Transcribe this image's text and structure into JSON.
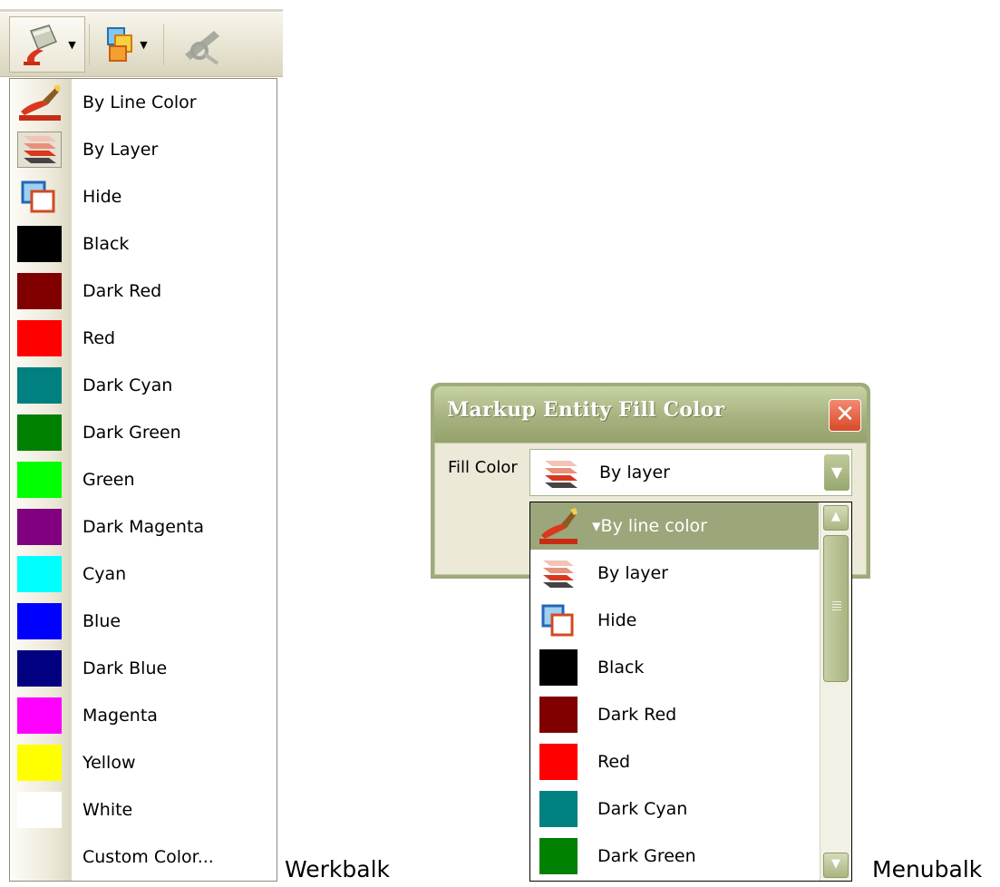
{
  "toolbar": {
    "buttons": [
      {
        "icon": "paint-bucket-icon",
        "has_dropdown": true
      },
      {
        "icon": "fill-color-squares-icon",
        "has_dropdown": true
      },
      {
        "icon": "line-style-icon",
        "has_dropdown": false
      }
    ],
    "menu_items": [
      {
        "label": "By Line Color",
        "icon": "brush-icon"
      },
      {
        "label": "By Layer",
        "icon": "layers-icon"
      },
      {
        "label": "Hide",
        "icon": "hide-squares-icon"
      },
      {
        "label": "Black",
        "color": "#000000"
      },
      {
        "label": "Dark Red",
        "color": "#800000"
      },
      {
        "label": "Red",
        "color": "#ff0000"
      },
      {
        "label": "Dark Cyan",
        "color": "#008080"
      },
      {
        "label": "Dark Green",
        "color": "#008000"
      },
      {
        "label": "Green",
        "color": "#00ff00"
      },
      {
        "label": "Dark Magenta",
        "color": "#800080"
      },
      {
        "label": "Cyan",
        "color": "#00ffff"
      },
      {
        "label": "Blue",
        "color": "#0000ff"
      },
      {
        "label": "Dark Blue",
        "color": "#000080"
      },
      {
        "label": "Magenta",
        "color": "#ff00ff"
      },
      {
        "label": "Yellow",
        "color": "#ffff00"
      },
      {
        "label": "White",
        "color": "#ffffff"
      },
      {
        "label": "Custom Color..."
      }
    ],
    "caption": "Werkbalk"
  },
  "dialog": {
    "title": "Markup Entity Fill Color",
    "fill_label": "Fill Color",
    "selected_value": "By layer",
    "list_items": [
      {
        "label": "By line color",
        "icon": "brush-icon",
        "selected": true
      },
      {
        "label": "By layer",
        "icon": "layers-icon"
      },
      {
        "label": "Hide",
        "icon": "hide-squares-icon"
      },
      {
        "label": "Black",
        "color": "#000000"
      },
      {
        "label": "Dark Red",
        "color": "#800000"
      },
      {
        "label": "Red",
        "color": "#ff0000"
      },
      {
        "label": "Dark Cyan",
        "color": "#008080"
      },
      {
        "label": "Dark Green",
        "color": "#008000"
      }
    ],
    "caption": "Menubalk",
    "theme_color": "#9eab7a"
  }
}
